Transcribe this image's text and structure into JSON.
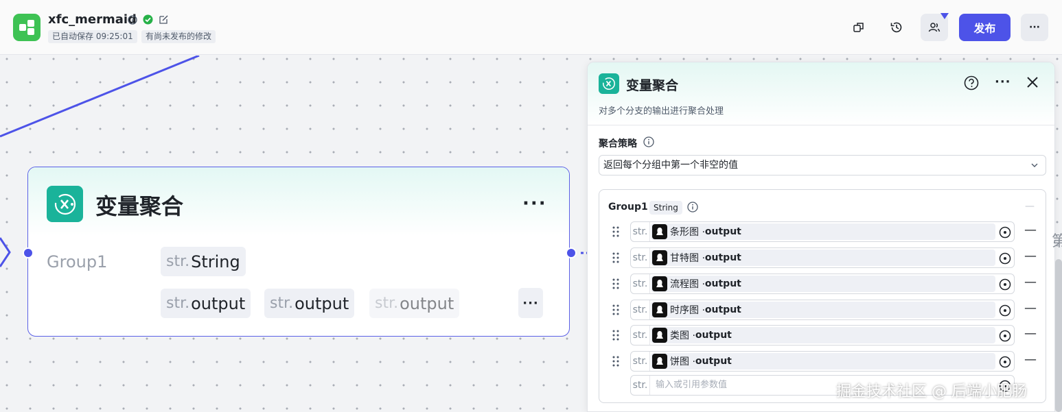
{
  "header": {
    "app_title": "xfc_mermaid",
    "autosave_text": "已自动保存 09:25:01",
    "unpublished_text": "有尚未发布的修改",
    "publish_label": "发布",
    "more_label": "···"
  },
  "node": {
    "title": "变量聚合",
    "more_label": "···",
    "group_name": "Group1",
    "type_prefix": "str.",
    "type_label": "String",
    "outputs": [
      {
        "prefix": "str.",
        "label": "output"
      },
      {
        "prefix": "str.",
        "label": "output"
      },
      {
        "prefix": "str.",
        "label": "output"
      }
    ],
    "overflow_label": "···"
  },
  "panel": {
    "title": "变量聚合",
    "more_label": "···",
    "description": "对多个分支的输出进行聚合处理",
    "strategy_label": "聚合策略",
    "strategy_value": "返回每个分组中第一个非空的值",
    "group": {
      "name": "Group1",
      "type": "String",
      "collapse": "—",
      "rows": [
        {
          "prefix": "str.",
          "source": "条形图 · ",
          "output": "output"
        },
        {
          "prefix": "str.",
          "source": "甘特图 · ",
          "output": "output"
        },
        {
          "prefix": "str.",
          "source": "流程图 · ",
          "output": "output"
        },
        {
          "prefix": "str.",
          "source": "时序图 · ",
          "output": "output"
        },
        {
          "prefix": "str.",
          "source": "类图 · ",
          "output": "output"
        },
        {
          "prefix": "str.",
          "source": "饼图 · ",
          "output": "output"
        }
      ],
      "new_row_prefix": "str.",
      "new_row_placeholder": "输入或引用参数值",
      "row_remove": "—"
    }
  },
  "watermark": "掘金技术社区 @ 后端小肥肠",
  "edge_char": "第",
  "colors": {
    "accent": "#4d53e8",
    "node_icon": "#1ab39a",
    "app_logo": "#3ec254"
  }
}
